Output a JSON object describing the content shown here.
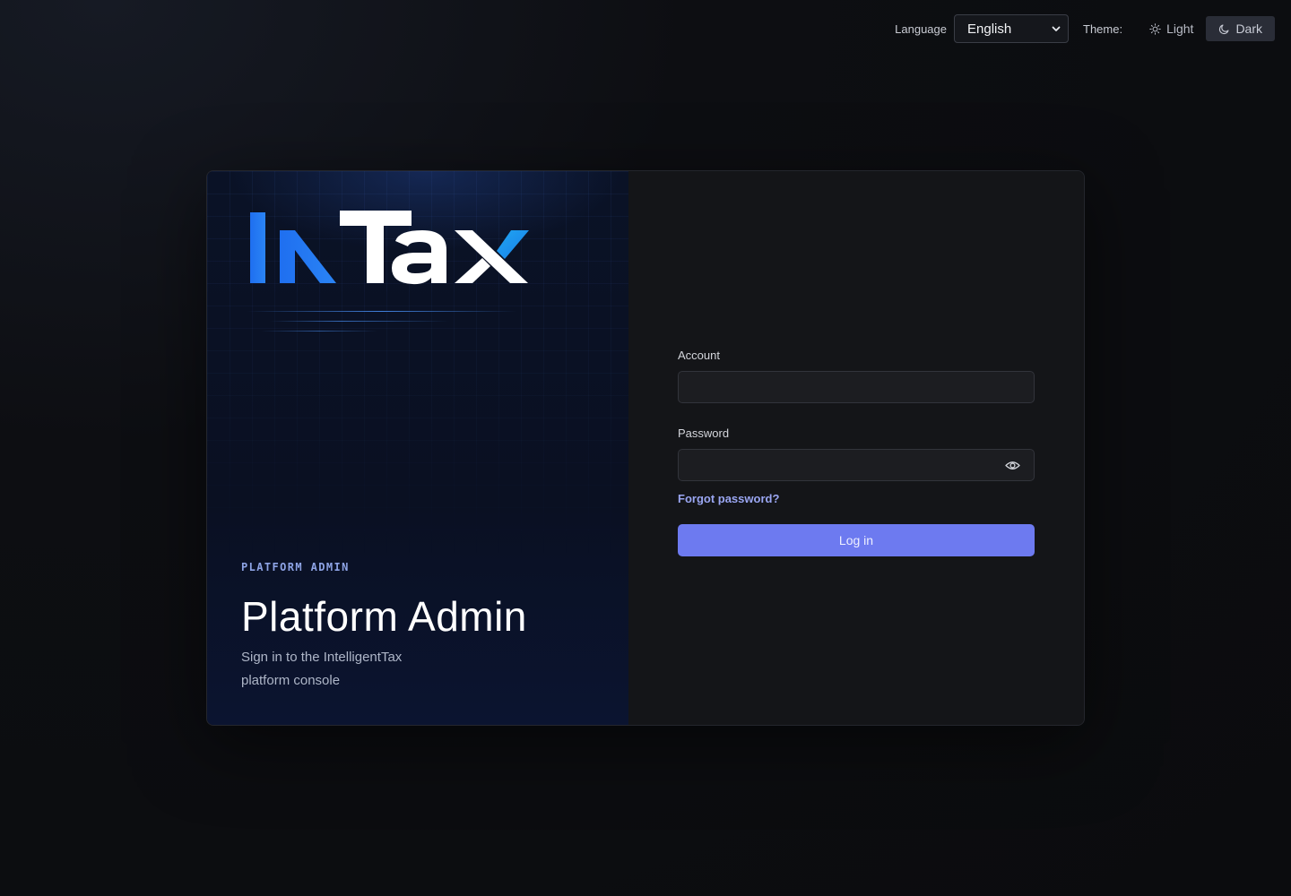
{
  "topbar": {
    "language_label": "Language",
    "language_value": "English",
    "theme_label": "Theme:",
    "theme_light": "Light",
    "theme_dark": "Dark",
    "active_theme": "Dark"
  },
  "hero": {
    "logo_text": "InTax",
    "eyebrow": "PLATFORM ADMIN",
    "title": "Platform Admin",
    "subtitle": "Sign in to the IntelligentTax platform console"
  },
  "form": {
    "account_label": "Account",
    "account_value": "",
    "password_label": "Password",
    "password_value": "",
    "forgot_link": "Forgot password?",
    "login_button": "Log in"
  },
  "colors": {
    "accent": "#6d7af0",
    "link": "#9aa6f2",
    "logo_blue": "#1e78f0",
    "logo_cyan": "#1fa0f0"
  },
  "icons": {
    "language_dropdown": "chevron-down-icon",
    "light": "sun-icon",
    "dark": "moon-icon",
    "password_toggle": "eye-icon"
  }
}
